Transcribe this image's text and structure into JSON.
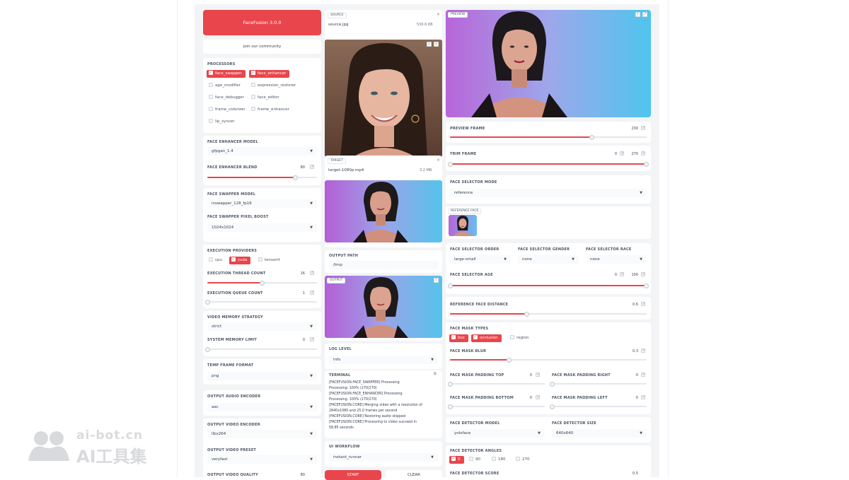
{
  "app": {
    "title_button": "FaceFusion 3.0.0",
    "community_button": "join our community"
  },
  "processors": {
    "label": "PROCESSORS",
    "items": [
      {
        "label": "face_swapper",
        "checked": true
      },
      {
        "label": "face_enhancer",
        "checked": true
      },
      {
        "label": "age_modifier",
        "checked": false
      },
      {
        "label": "expression_restorer",
        "checked": false
      },
      {
        "label": "face_debugger",
        "checked": false
      },
      {
        "label": "face_editor",
        "checked": false
      },
      {
        "label": "frame_colorizer",
        "checked": false
      },
      {
        "label": "frame_enhancer",
        "checked": false
      },
      {
        "label": "lip_syncer",
        "checked": false
      }
    ]
  },
  "face_enhancer": {
    "model_label": "FACE ENHANCER MODEL",
    "model_value": "gfpgan_1.4",
    "blend_label": "FACE ENHANCER BLEND",
    "blend_value": "80",
    "blend_fraction": 0.8
  },
  "face_swapper": {
    "model_label": "FACE SWAPPER MODEL",
    "model_value": "inswapper_128_fp16",
    "pixel_boost_label": "FACE SWAPPER PIXEL BOOST",
    "pixel_boost_value": "1024x1024"
  },
  "execution": {
    "providers_label": "EXECUTION PROVIDERS",
    "providers": [
      {
        "label": "cpu",
        "checked": false
      },
      {
        "label": "cuda",
        "checked": true
      },
      {
        "label": "tensorrt",
        "checked": false
      }
    ],
    "thread_label": "EXECUTION THREAD COUNT",
    "thread_value": "16",
    "thread_fraction": 0.5,
    "queue_label": "EXECUTION QUEUE COUNT",
    "queue_value": "1",
    "queue_fraction": 0.0
  },
  "memory": {
    "strategy_label": "VIDEO MEMORY STRATEGY",
    "strategy_value": "strict",
    "limit_label": "SYSTEM MEMORY LIMIT",
    "limit_value": "0",
    "limit_fraction": 0.0
  },
  "temp": {
    "label": "TEMP FRAME FORMAT",
    "value": "png"
  },
  "output_audio": {
    "label": "OUTPUT AUDIO ENCODER",
    "value": "aac"
  },
  "output_video": {
    "encoder_label": "OUTPUT VIDEO ENCODER",
    "encoder_value": "libx264",
    "preset_label": "OUTPUT VIDEO PRESET",
    "preset_value": "veryfast",
    "quality_label": "OUTPUT VIDEO QUALITY",
    "quality_value": "80"
  },
  "source": {
    "tag": "SOURCE",
    "file": "source.jpg",
    "size": "530.6 KB"
  },
  "target": {
    "tag": "TARGET",
    "file": "target-1080p.mp4",
    "size": "3.2 MB"
  },
  "output_path": {
    "label": "OUTPUT PATH",
    "value": "/tmp"
  },
  "output": {
    "tag": "OUTPUT"
  },
  "log": {
    "label": "LOG LEVEL",
    "value": "info"
  },
  "terminal": {
    "label": "TERMINAL",
    "lines": [
      "[FACEFUSION.FACE_SWAPPER] Processing",
      "Processing: 100% (270/270)",
      "[FACEFUSION.FACE_ENHANCER] Processing",
      "Processing: 100% (270/270)",
      "[FACEFUSION.CORE] Merging video with a resolution of",
      "2840x1080 and 25.0 frames per second",
      "[FACEFUSION.CORE] Restoring audio skipped",
      "[FACEFUSION.CORE] Processing to video succeed in",
      "58.85 seconds"
    ]
  },
  "ui_workflow": {
    "label": "UI WORKFLOW",
    "value": "instant_runner"
  },
  "actions": {
    "start": "START",
    "clear": "CLEAR"
  },
  "preview": {
    "tag": "PREVIEW",
    "frame_label": "PREVIEW FRAME",
    "frame_value": "230",
    "frame_fraction": 0.72
  },
  "trim": {
    "label": "TRIM FRAME",
    "start": "0",
    "end": "270"
  },
  "face_selector": {
    "mode_label": "FACE SELECTOR MODE",
    "mode_value": "reference",
    "reference_label": "REFERENCE FACE",
    "order_label": "FACE SELECTOR ORDER",
    "order_value": "large-small",
    "gender_label": "FACE SELECTOR GENDER",
    "gender_value": "none",
    "race_label": "FACE SELECTOR RACE",
    "race_value": "none",
    "age_label": "FACE SELECTOR AGE",
    "age_start": "0",
    "age_end": "100"
  },
  "reference_distance": {
    "label": "REFERENCE FACE DISTANCE",
    "value": "0.6",
    "fraction": 0.39
  },
  "face_mask": {
    "types_label": "FACE MASK TYPES",
    "types": [
      {
        "label": "box",
        "checked": true
      },
      {
        "label": "occlusion",
        "checked": true
      },
      {
        "label": "region",
        "checked": false
      }
    ],
    "blur_label": "FACE MASK BLUR",
    "blur_value": "0.3",
    "blur_fraction": 0.3,
    "pad_top_label": "FACE MASK PADDING TOP",
    "pad_top_value": "0",
    "pad_right_label": "FACE MASK PADDING RIGHT",
    "pad_right_value": "0",
    "pad_bottom_label": "FACE MASK PADDING BOTTOM",
    "pad_bottom_value": "0",
    "pad_left_label": "FACE MASK PADDING LEFT",
    "pad_left_value": "0"
  },
  "face_detector": {
    "model_label": "FACE DETECTOR MODEL",
    "model_value": "yoloface",
    "size_label": "FACE DETECTOR SIZE",
    "size_value": "640x640",
    "angles_label": "FACE DETECTOR ANGLES",
    "angles": [
      {
        "label": "0",
        "checked": true
      },
      {
        "label": "90",
        "checked": false
      },
      {
        "label": "180",
        "checked": false
      },
      {
        "label": "270",
        "checked": false
      }
    ],
    "score_label": "FACE DETECTOR SCORE",
    "score_value": "0.5"
  },
  "watermark": {
    "line1": "ai-bot.cn",
    "line2": "AI工具集"
  },
  "colors": {
    "accent": "#e9454c",
    "panel": "#ffffff",
    "background": "#f3f4f6"
  }
}
